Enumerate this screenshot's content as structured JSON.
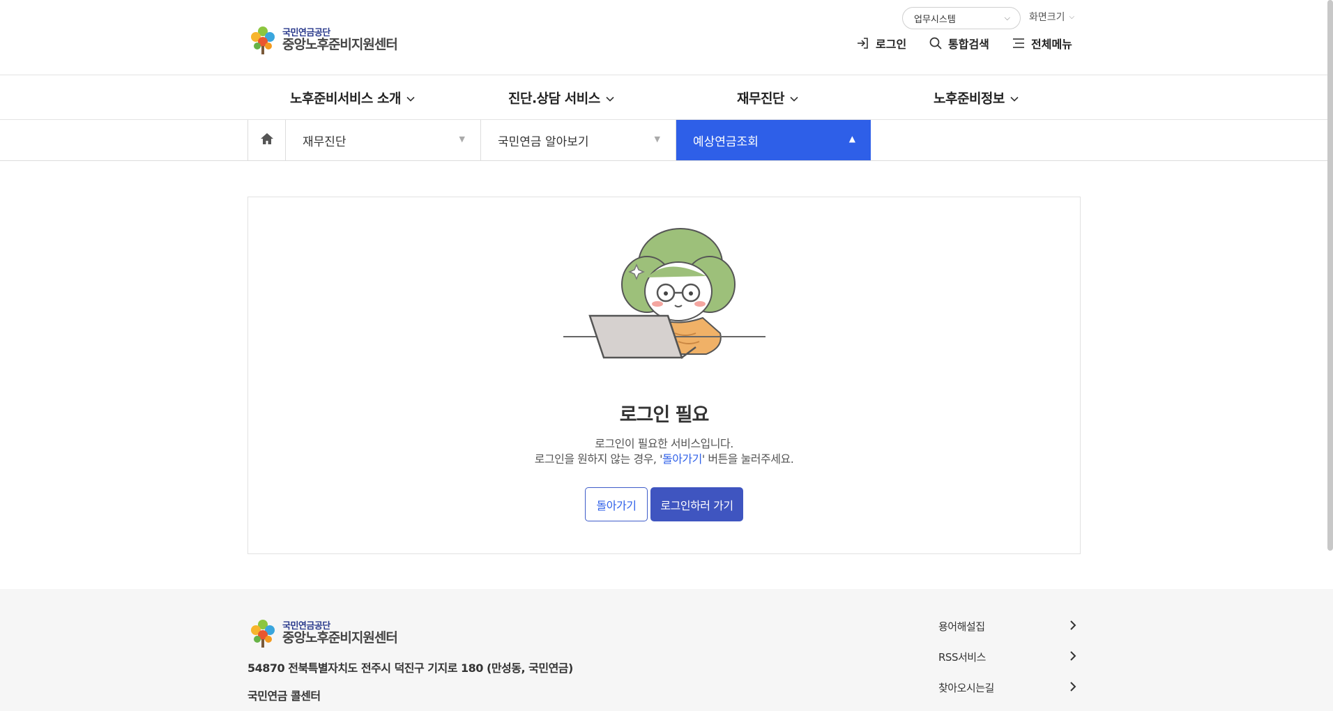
{
  "header": {
    "logo_org": "국민연금공단",
    "logo_center": "중앙노후준비지원센터",
    "system_select": "업무시스템",
    "screen_size": "화면크기",
    "util": {
      "login": "로그인",
      "search": "통합검색",
      "menu": "전체메뉴"
    }
  },
  "gnb": {
    "items": [
      {
        "label": "노후준비서비스 소개"
      },
      {
        "label": "진단.상담 서비스"
      },
      {
        "label": "재무진단"
      },
      {
        "label": "노후준비정보"
      }
    ]
  },
  "location": {
    "depth1": "재무진단",
    "depth2": "국민연금 알아보기",
    "depth3": "예상연금조회"
  },
  "notice": {
    "title": "로그인 필요",
    "line1": "로그인이 필요한 서비스입니다.",
    "line2_prefix": "로그인을 원하지 않는 경우, '",
    "line2_highlight": "돌아가기",
    "line2_suffix": "' 버튼을 눌러주세요.",
    "back_button": "돌아가기",
    "login_button": "로그인하러 가기"
  },
  "footer": {
    "logo_org": "국민연금공단",
    "logo_center": "중앙노후준비지원센터",
    "address": "54870 전북특별자치도 전주시 덕진구 기지로 180 (만성동, 국민연금)",
    "call_center": "국민연금 콜센터",
    "links": [
      {
        "label": "용어해설집"
      },
      {
        "label": "RSS서비스"
      },
      {
        "label": "찾아오시는길"
      }
    ]
  },
  "colors": {
    "accent": "#2e5fe8",
    "button_primary": "#3f55c0",
    "footer_bg": "#f6f6f6"
  }
}
